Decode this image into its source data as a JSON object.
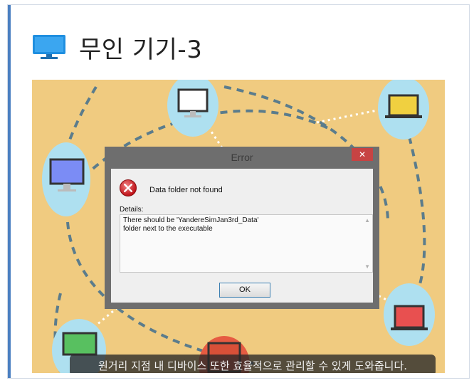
{
  "header": {
    "icon": "monitor-icon",
    "title": "무인 기기-3"
  },
  "slide": {
    "background_color": "#f0cb80",
    "subtitle": "원거리 지점 내 디바이스 또한 효율적으로 관리할 수 있게 도와줍니다."
  },
  "dialog": {
    "title": "Error",
    "close_label": "✕",
    "message": "Data folder not found",
    "details_label": "Details:",
    "details_lines": [
      "There should be 'YandereSimJan3rd_Data'",
      "folder next to the executable"
    ],
    "ok_label": "OK"
  },
  "colors": {
    "accent": "#4a7fc1",
    "close_button": "#c74343",
    "device_bubble": "#aee0f0"
  }
}
